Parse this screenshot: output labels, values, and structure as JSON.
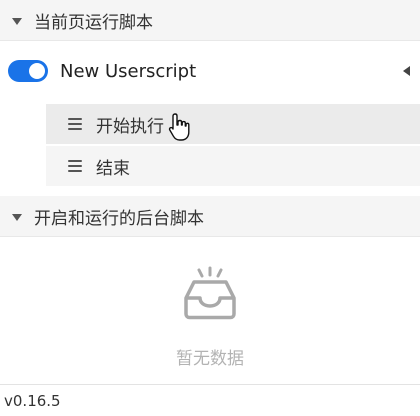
{
  "sections": {
    "current_page": {
      "title": "当前页运行脚本"
    },
    "background": {
      "title": "开启和运行的后台脚本",
      "empty_text": "暂无数据"
    }
  },
  "script": {
    "name": "New Userscript",
    "enabled": true,
    "menu_items": [
      {
        "label": "开始执行",
        "icon": "hamburger-icon",
        "state": "hovered"
      },
      {
        "label": "结束",
        "icon": "hamburger-icon",
        "state": "normal"
      }
    ]
  },
  "footer": {
    "version": "v0.16.5"
  },
  "colors": {
    "toggle_on": "#1a73e8",
    "section_bg": "#f5f5f5",
    "hover_bg": "#ebebeb",
    "empty_text": "#b3b3b3"
  }
}
